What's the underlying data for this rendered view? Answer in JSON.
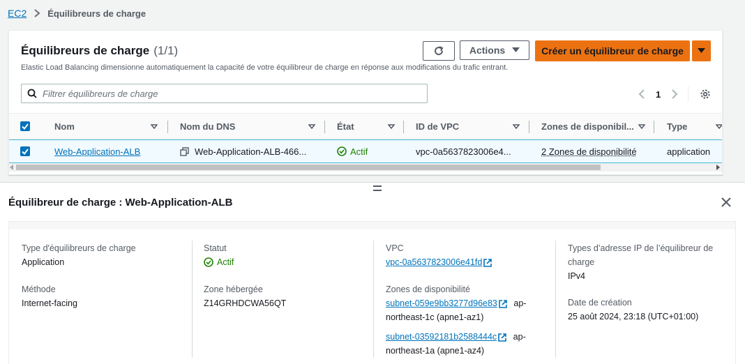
{
  "breadcrumb": {
    "root": "EC2",
    "current": "Équilibreurs de charge"
  },
  "list": {
    "title": "Équilibreurs de charge",
    "count": "(1/1)",
    "description": "Elastic Load Balancing dimensionne automatiquement la capacité de votre équilibreur de charge en réponse aux modifications du trafic entrant.",
    "actions_label": "Actions",
    "create_label": "Créer un équilibreur de charge",
    "filter_placeholder": "Filtrer équilibreurs de charge",
    "page": "1",
    "columns": [
      "Nom",
      "Nom du DNS",
      "État",
      "ID de VPC",
      "Zones de disponibil...",
      "Type"
    ],
    "row": {
      "name": "Web-Application-ALB",
      "dns": "Web-Application-ALB-466...",
      "state": "Actif",
      "vpc": "vpc-0a5637823006e4...",
      "zones": "2 Zones de disponibilité",
      "type": "application"
    }
  },
  "detail": {
    "title": "Équilibreur de charge : Web-Application-ALB",
    "lb_type_label": "Type d'équilibreurs de charge",
    "lb_type": "Application",
    "method_label": "Méthode",
    "method": "Internet-facing",
    "status_label": "Statut",
    "status": "Actif",
    "hosted_zone_label": "Zone hébergée",
    "hosted_zone": "Z14GRHDCWA56QT",
    "vpc_label": "VPC",
    "vpc": "vpc-0a5637823006e41fd",
    "az_label": "Zones de disponibilité",
    "subnet1": "subnet-059e9bb3277d96e83",
    "subnet1_suffix": "ap-",
    "subnet1_zone": "northeast-1c (apne1-az1)",
    "subnet2": "subnet-03592181b2588444c",
    "subnet2_suffix": "ap-",
    "subnet2_zone": "northeast-1a (apne1-az4)",
    "ip_types_label_1": "Types d’adresse IP de l’équilibreur de",
    "ip_types_label_2": "charge",
    "ip_types": "IPv4",
    "created_label": "Date de création",
    "created": "25 août 2024, 23:18 (UTC+01:00)"
  },
  "colors": {
    "link": "#0073bb",
    "primary": "#ec7211",
    "success": "#1d8102",
    "selected_row": "#f1faff"
  },
  "icons": [
    "chevron-right-icon",
    "refresh-icon",
    "caret-down-icon",
    "search-icon",
    "chevron-left-icon",
    "gear-icon",
    "sort-icon",
    "copy-icon",
    "check-circle-icon",
    "external-link-icon",
    "close-icon"
  ]
}
